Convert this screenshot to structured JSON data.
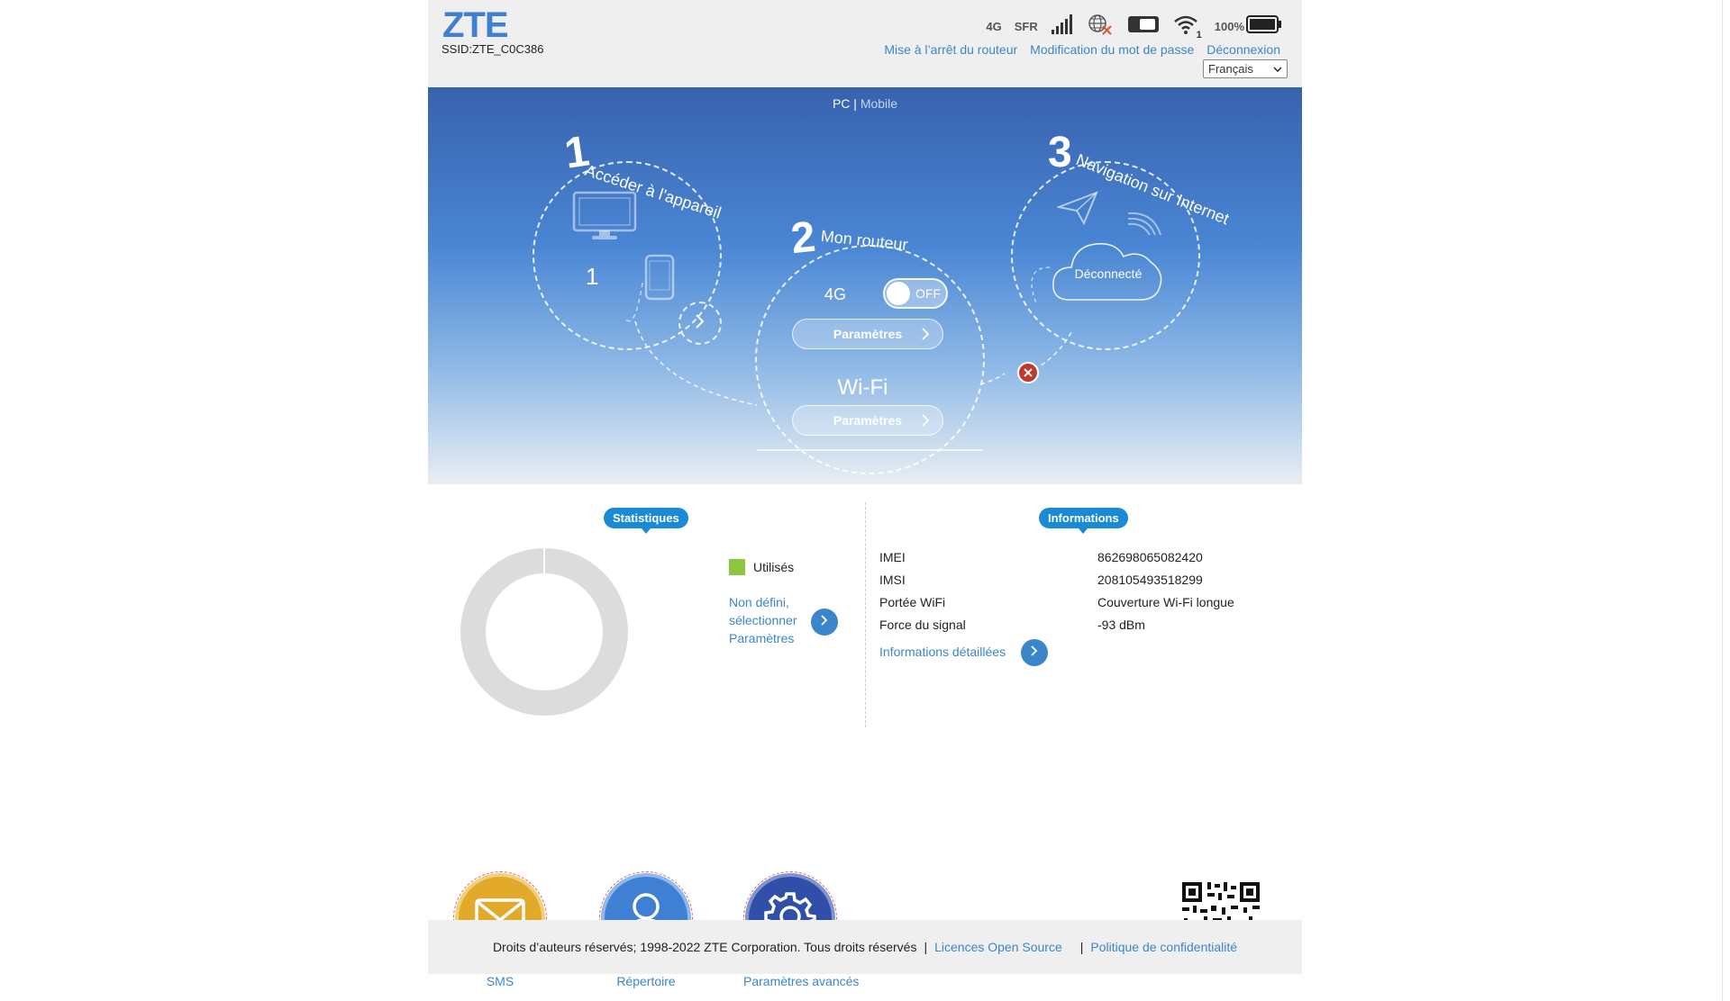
{
  "header": {
    "logo": "ZTE",
    "ssid": "SSID:ZTE_C0C386",
    "network_type": "4G",
    "operator": "SFR",
    "wifi_clients": "1",
    "battery": "100%",
    "links": {
      "shutdown": "Mise à l’arrêt du routeur",
      "change_password": "Modification du mot de passe",
      "logout": "Déconnexion"
    },
    "language": "Français"
  },
  "hero": {
    "mode_pc": "PC",
    "separator": "|",
    "mode_mobile": "Mobile",
    "step1": {
      "number": "1",
      "title": "Accéder à l'appareil",
      "device_count": "1"
    },
    "step2": {
      "number": "2",
      "title": "Mon routeur",
      "cellular_label": "4G",
      "toggle_state": "OFF",
      "cellular_params": "Paramètres",
      "wifi_label": "Wi-Fi",
      "wifi_params": "Paramètres"
    },
    "step3": {
      "number": "3",
      "title": "Navigation sur Internet",
      "status": "Déconnecté"
    }
  },
  "statistics": {
    "badge": "Statistiques",
    "legend_used": "Utilisés",
    "used_color": "#8cc63f",
    "undefined_line1": "Non défini,",
    "undefined_line2": "sélectionner",
    "undefined_line3": "Paramètres"
  },
  "information": {
    "badge": "Informations",
    "rows": [
      {
        "label": "IMEI",
        "value": "862698065082420"
      },
      {
        "label": "IMSI",
        "value": "208105493518299"
      },
      {
        "label": "Portée WiFi",
        "value": "Couverture Wi-Fi longue"
      },
      {
        "label": "Force du signal",
        "value": "-93 dBm"
      }
    ],
    "details_link": "Informations détaillées"
  },
  "shortcuts": {
    "sms": "SMS",
    "phonebook": "Répertoire",
    "advanced": "Paramètres avancés"
  },
  "footer": {
    "copyright": "Droits d’auteurs réservés; 1998-2022 ZTE Corporation. Tous droits réservés",
    "sep": "|",
    "open_source": "Licences Open Source",
    "privacy": "Politique de confidentialité"
  },
  "colors": {
    "accent": "#3b86c9",
    "badge": "#1a8ad6",
    "sms_disc": "#e2a92a",
    "phonebook_disc": "#3f7fd4",
    "advanced_disc": "#2f4fa8",
    "disconnect_x": "#c0392b"
  }
}
